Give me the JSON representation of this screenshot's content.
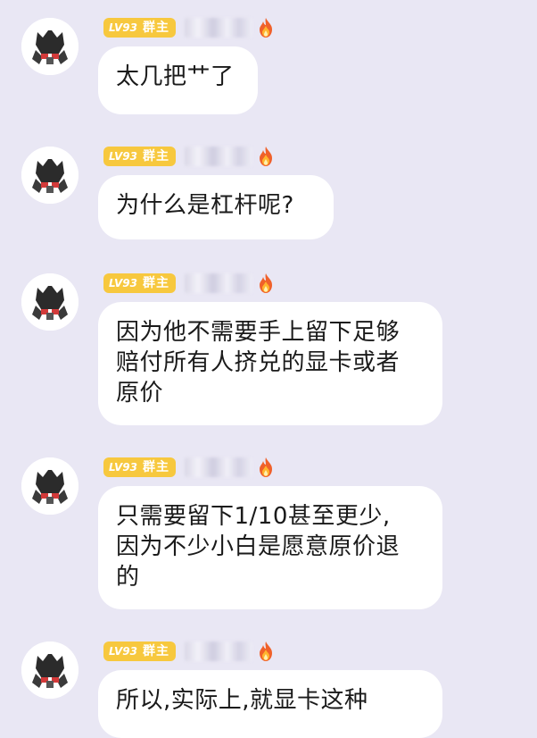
{
  "colors": {
    "background": "#e9e7f4",
    "bubble": "#ffffff",
    "badge": "#f7c83e",
    "text": "#1a1a1a"
  },
  "messages": [
    {
      "badge_level": "LV93",
      "badge_role": "群主",
      "text": "太几把艹了"
    },
    {
      "badge_level": "LV93",
      "badge_role": "群主",
      "text": "为什么是杠杆呢?"
    },
    {
      "badge_level": "LV93",
      "badge_role": "群主",
      "text": "因为他不需要手上留下足够\n赔付所有人挤兑的显卡或者\n原价"
    },
    {
      "badge_level": "LV93",
      "badge_role": "群主",
      "text": "只需要留下1/10甚至更少,\n因为不少小白是愿意原价退\n的"
    },
    {
      "badge_level": "LV93",
      "badge_role": "群主",
      "text": "所以,实际上,就显卡这种"
    }
  ]
}
